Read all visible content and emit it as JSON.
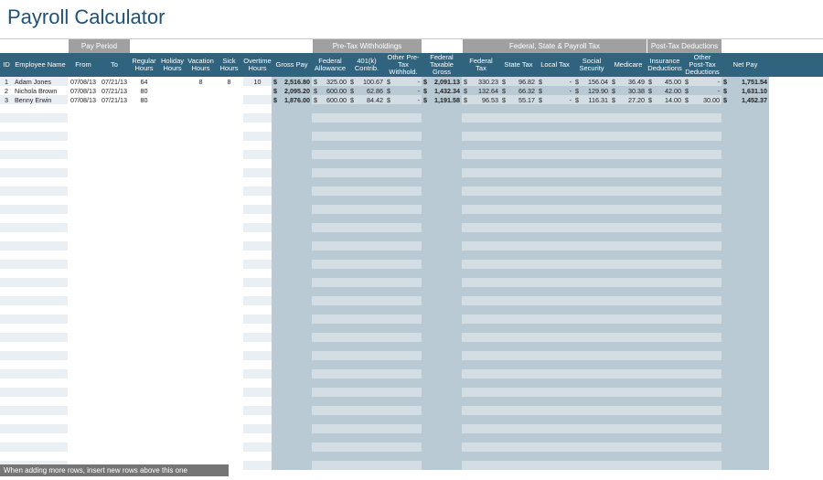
{
  "title": "Payroll Calculator",
  "groups": [
    {
      "label": "",
      "span": [
        "c-id",
        "c-name"
      ],
      "bg": "transparent"
    },
    {
      "label": "Pay Period",
      "span": [
        "c-from",
        "c-to"
      ],
      "bg": "#a0a0a0"
    },
    {
      "label": "",
      "span": [
        "c-reg",
        "c-hol",
        "c-vac",
        "c-sick",
        "c-ot"
      ],
      "bg": "transparent"
    },
    {
      "label": "",
      "span": [
        "c-gross"
      ],
      "bg": "transparent"
    },
    {
      "label": "Pre-Tax Withholdings",
      "span": [
        "c-fedal",
        "c-401k",
        "c-otherpre"
      ],
      "bg": "#a0a0a0"
    },
    {
      "label": "",
      "span": [
        "c-taxgross"
      ],
      "bg": "transparent"
    },
    {
      "label": "Federal, State & Payroll Tax",
      "span": [
        "c-fedtax",
        "c-stax",
        "c-ltax",
        "c-ss",
        "c-med"
      ],
      "bg": "#a0a0a0"
    },
    {
      "label": "Post-Tax Deductions",
      "span": [
        "c-ins",
        "c-otherpost"
      ],
      "bg": "#a0a0a0"
    },
    {
      "label": "",
      "span": [
        "c-net"
      ],
      "bg": "transparent"
    }
  ],
  "columns": [
    {
      "key": "id",
      "label": "ID",
      "cls": "c-id",
      "align": "center",
      "shade": "a"
    },
    {
      "key": "name",
      "label": "Employee Name",
      "cls": "c-name",
      "align": "left",
      "shade": "a"
    },
    {
      "key": "from",
      "label": "From",
      "cls": "c-from",
      "align": "center",
      "shade": "white"
    },
    {
      "key": "to",
      "label": "To",
      "cls": "c-to",
      "align": "center",
      "shade": "white"
    },
    {
      "key": "reg",
      "label": "Regular Hours",
      "cls": "c-reg",
      "align": "center",
      "shade": "white"
    },
    {
      "key": "hol",
      "label": "Holiday Hours",
      "cls": "c-hol",
      "align": "center",
      "shade": "white"
    },
    {
      "key": "vac",
      "label": "Vacation Hours",
      "cls": "c-vac",
      "align": "center",
      "shade": "white"
    },
    {
      "key": "sick",
      "label": "Sick Hours",
      "cls": "c-sick",
      "align": "center",
      "shade": "white"
    },
    {
      "key": "ot",
      "label": "Overtime Hours",
      "cls": "c-ot",
      "align": "center",
      "shade": "a"
    },
    {
      "key": "gross",
      "label": "Gross Pay",
      "cls": "c-gross",
      "align": "money",
      "shade": "b",
      "bold": true
    },
    {
      "key": "fedal",
      "label": "Federal Allowance",
      "cls": "c-fedal",
      "align": "money",
      "shade": "c"
    },
    {
      "key": "k401",
      "label": "401(k) Contrib.",
      "cls": "c-401k",
      "align": "money",
      "shade": "c"
    },
    {
      "key": "otherpre",
      "label": "Other Pre-Tax Withhold.",
      "cls": "c-otherpre",
      "align": "money",
      "shade": "c"
    },
    {
      "key": "taxgross",
      "label": "Federal Taxable Gross",
      "cls": "c-taxgross",
      "align": "money",
      "shade": "b",
      "bold": true
    },
    {
      "key": "fedtax",
      "label": "Federal Tax",
      "cls": "c-fedtax",
      "align": "money",
      "shade": "c"
    },
    {
      "key": "stax",
      "label": "State Tax",
      "cls": "c-stax",
      "align": "money",
      "shade": "c"
    },
    {
      "key": "ltax",
      "label": "Local Tax",
      "cls": "c-ltax",
      "align": "money",
      "shade": "c"
    },
    {
      "key": "ss",
      "label": "Social Security",
      "cls": "c-ss",
      "align": "money",
      "shade": "c"
    },
    {
      "key": "med",
      "label": "Medicare",
      "cls": "c-med",
      "align": "money",
      "shade": "c"
    },
    {
      "key": "ins",
      "label": "Insurance Deductions",
      "cls": "c-ins",
      "align": "money",
      "shade": "c"
    },
    {
      "key": "otherpost",
      "label": "Other Post-Tax Deductions",
      "cls": "c-otherpost",
      "align": "money",
      "shade": "c"
    },
    {
      "key": "net",
      "label": "Net Pay",
      "cls": "c-net",
      "align": "money",
      "shade": "b",
      "bold": true
    }
  ],
  "rows": [
    {
      "id": "1",
      "name": "Adam Jones",
      "from": "07/08/13",
      "to": "07/21/13",
      "reg": "64",
      "hol": "",
      "vac": "8",
      "sick": "8",
      "ot": "10",
      "gross": "2,516.80",
      "fedal": "325.00",
      "k401": "100.67",
      "otherpre": "-",
      "taxgross": "2,091.13",
      "fedtax": "330.23",
      "stax": "96.82",
      "ltax": "-",
      "ss": "156.04",
      "med": "36.49",
      "ins": "45.00",
      "otherpost": "-",
      "net": "1,751.54"
    },
    {
      "id": "2",
      "name": "Nichola Brown",
      "from": "07/08/13",
      "to": "07/21/13",
      "reg": "80",
      "hol": "",
      "vac": "",
      "sick": "",
      "ot": "",
      "gross": "2,095.20",
      "fedal": "600.00",
      "k401": "62.86",
      "otherpre": "-",
      "taxgross": "1,432.34",
      "fedtax": "132.64",
      "stax": "66.32",
      "ltax": "-",
      "ss": "129.90",
      "med": "30.38",
      "ins": "42.00",
      "otherpost": "-",
      "net": "1,631.10"
    },
    {
      "id": "3",
      "name": "Benny Erwin",
      "from": "07/08/13",
      "to": "07/21/13",
      "reg": "80",
      "hol": "",
      "vac": "",
      "sick": "",
      "ot": "",
      "gross": "1,876.00",
      "fedal": "600.00",
      "k401": "84.42",
      "otherpre": "-",
      "taxgross": "1,191.58",
      "fedtax": "96.53",
      "stax": "55.17",
      "ltax": "-",
      "ss": "116.31",
      "med": "27.20",
      "ins": "14.00",
      "otherpost": "30.00",
      "net": "1,452.37"
    }
  ],
  "empty_rows": 40,
  "footer_note": "When adding more rows, insert new rows above this one",
  "currency": "$"
}
